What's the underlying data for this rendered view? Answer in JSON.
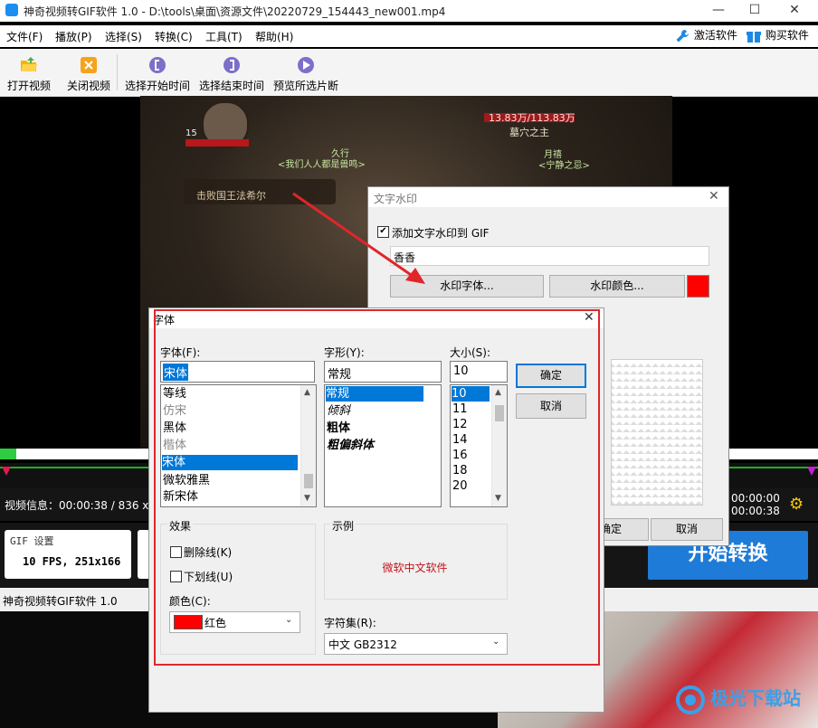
{
  "window": {
    "title": "神奇视频转GIF软件 1.0 - D:\\tools\\桌面\\资源文件\\20220729_154443_new001.mp4",
    "minimize": "—",
    "maximize": "☐",
    "close": "✕"
  },
  "menu": {
    "items": [
      "文件(F)",
      "播放(P)",
      "选择(S)",
      "转换(C)",
      "工具(T)",
      "帮助(H)"
    ],
    "activate": "激活软件",
    "buy": "购买软件"
  },
  "toolbar": {
    "open": "打开视频",
    "close": "关闭视频",
    "select_start": "选择开始时间",
    "select_end": "选择结束时间",
    "preview": "预览所选片断"
  },
  "video_info": {
    "label": "视频信息：00:00:38 / 836 x",
    "time_start": "00:00:00",
    "time_end": "00:00:38"
  },
  "gif": {
    "settings_title": "GIF 设置",
    "settings_value": "10 FPS, 251x166",
    "convert_button": "开始转换",
    "timeline_progress": 0.02
  },
  "statusbar": {
    "text": "神奇视频转GIF软件 1.0"
  },
  "watermark_dialog": {
    "title": "文字水印",
    "enable_label": "添加文字水印到 GIF",
    "enabled": true,
    "text_value": "香香",
    "font_button": "水印字体...",
    "color_button": "水印颜色...",
    "color": "#ff0000",
    "ok": "确定",
    "cancel": "取消"
  },
  "font_dialog": {
    "title": "字体",
    "font_label": "字体(F):",
    "font_value": "宋体",
    "fonts": [
      "等线",
      "仿宋",
      "黑体",
      "楷体",
      "宋体",
      "微软雅黑",
      "新宋体"
    ],
    "selected_font": "宋体",
    "style_label": "字形(Y):",
    "style_value": "常规",
    "styles": [
      "常规",
      "倾斜",
      "粗体",
      "粗偏斜体"
    ],
    "size_label": "大小(S):",
    "size_value": "10",
    "sizes": [
      "10",
      "11",
      "12",
      "14",
      "16",
      "18",
      "20"
    ],
    "ok": "确定",
    "cancel": "取消",
    "effects_label": "效果",
    "strikeout_label": "删除线(K)",
    "underline_label": "下划线(U)",
    "color_label": "颜色(C):",
    "color_value": "红色",
    "color_swatch": "#ff0000",
    "sample_label": "示例",
    "sample_text": "微软中文软件",
    "charset_label": "字符集(R):",
    "charset_value": "中文 GB2312"
  },
  "game_overlay": {
    "top_bar": "13.83万/113.83万",
    "boss_name": "墓穴之主",
    "player_left": "久行",
    "player_right": "月禧",
    "chat_left": "<我们人人都是兽鸣>",
    "chat_right": "<宁静之忌>",
    "objective": "击败国王法希尔",
    "level": "15"
  },
  "logo": {
    "text": "极光下载站"
  },
  "colors": {
    "accent": "#1e88e5",
    "highlight_red": "#e0262b",
    "convert_blue": "#1e7bd8",
    "progress_green": "#2ecc40"
  }
}
